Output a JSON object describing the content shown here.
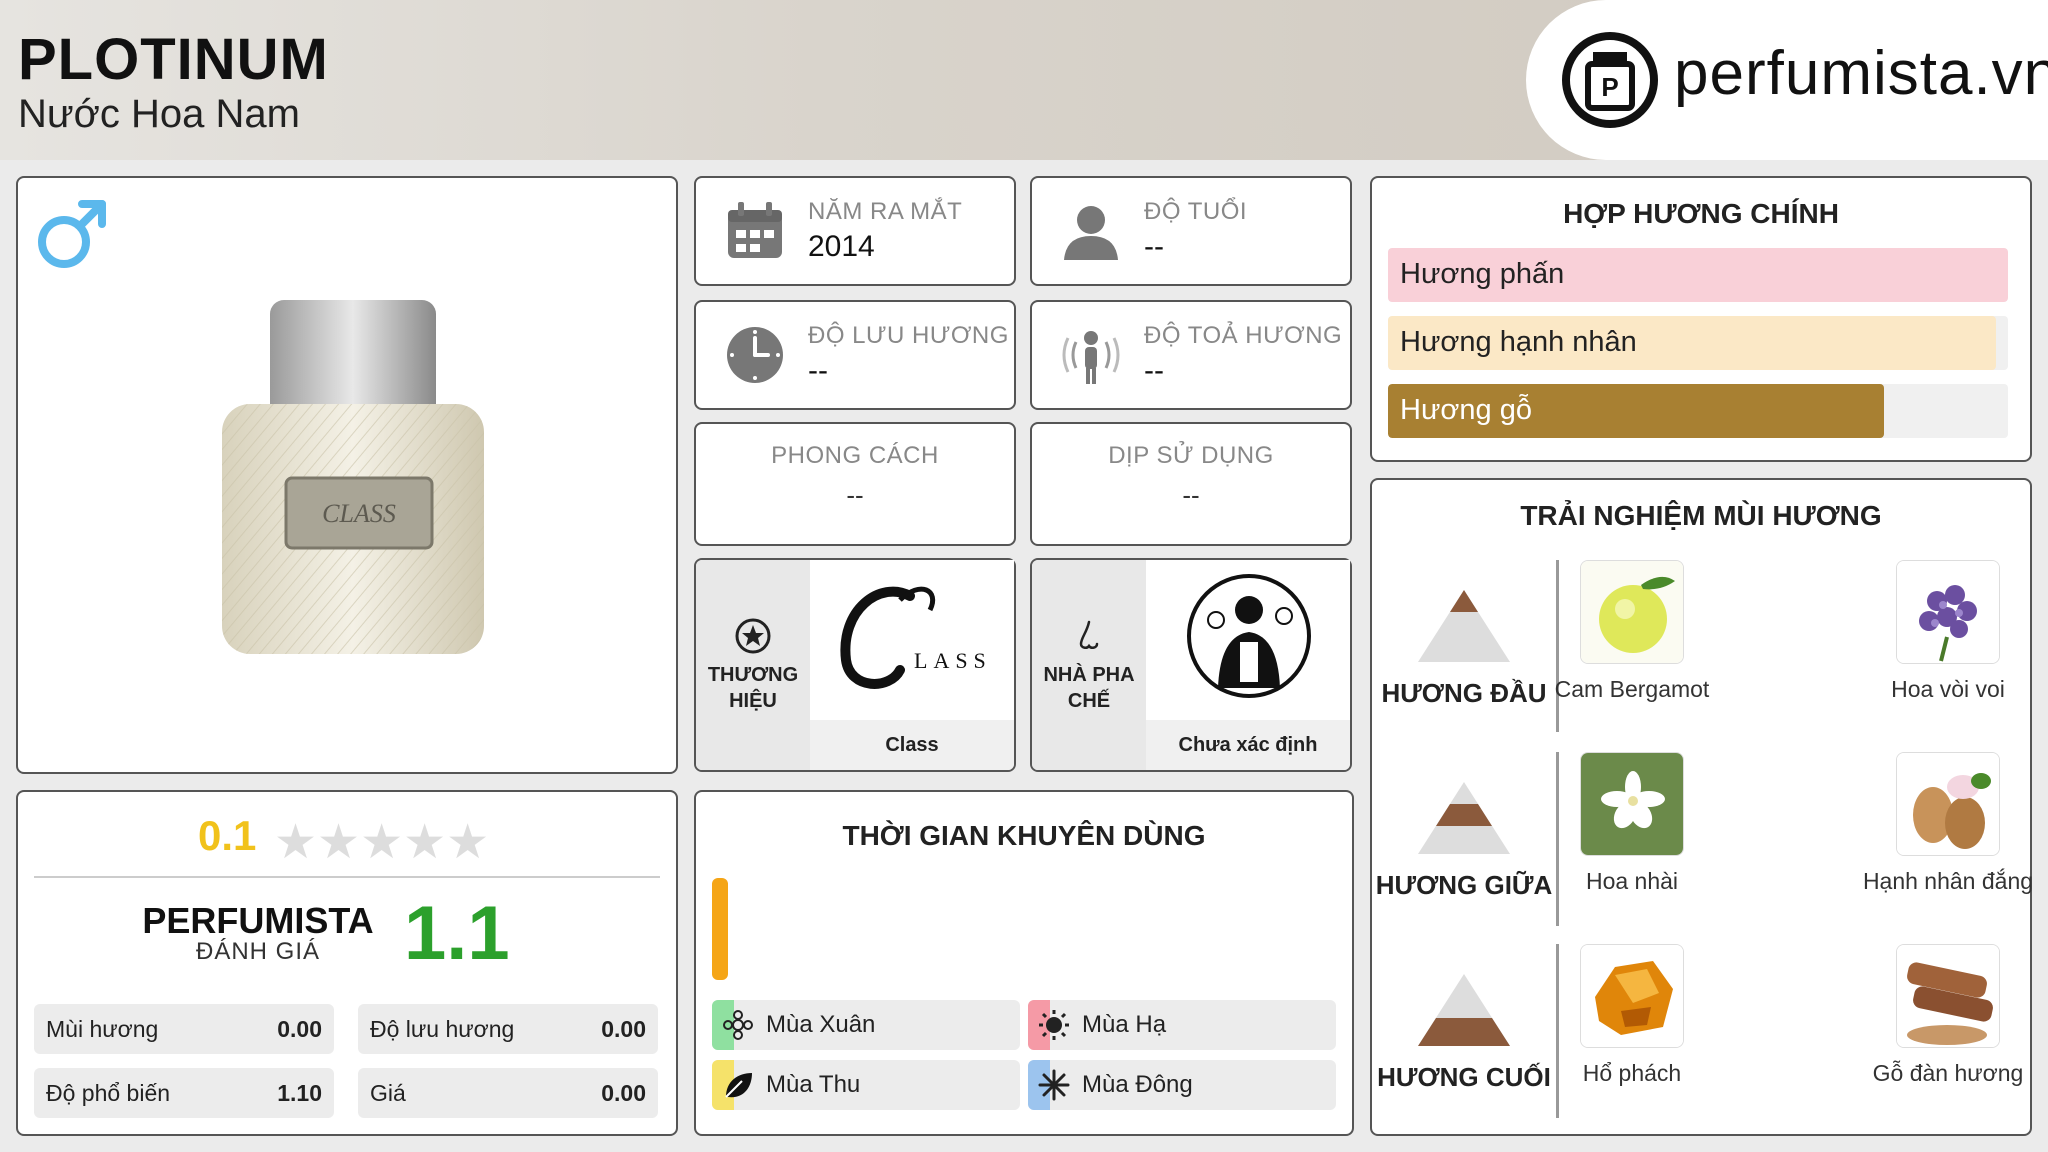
{
  "header": {
    "title": "PLOTINUM",
    "subtitle": "Nước Hoa Nam",
    "logo_text": "perfumista.vn"
  },
  "product": {
    "gender_icon": "male-symbol-icon",
    "bottle_label": "CLASS"
  },
  "info": {
    "launch_year": {
      "label": "NĂM RA MẮT",
      "value": "2014",
      "icon": "calendar-icon"
    },
    "age": {
      "label": "ĐỘ TUỔI",
      "value": "--",
      "icon": "person-icon"
    },
    "longevity": {
      "label": "ĐỘ LƯU HƯƠNG",
      "value": "--",
      "icon": "clock-icon"
    },
    "sillage": {
      "label": "ĐỘ TOẢ HƯƠNG",
      "value": "--",
      "icon": "radiating-person-icon"
    },
    "style": {
      "label": "PHONG CÁCH",
      "value": "--"
    },
    "occasion": {
      "label": "DỊP SỬ DỤNG",
      "value": "--"
    }
  },
  "brand": {
    "label": "THƯƠNG HIỆU",
    "name": "Class",
    "logo_text": "LASS"
  },
  "perfumer": {
    "label": "NHÀ PHA CHẾ",
    "name": "Chưa xác định"
  },
  "accords": {
    "title": "HỢP HƯƠNG CHÍNH",
    "items": [
      {
        "label": "Hương phấn",
        "fill": 1.0,
        "color": "#f9d0d8",
        "text_color": "#222222"
      },
      {
        "label": "Hương hạnh nhân",
        "fill": 0.98,
        "color": "#fbe8c6",
        "text_color": "#222222"
      },
      {
        "label": "Hương gỗ",
        "fill": 0.8,
        "color": "#a88032",
        "text_color": "#ffffff"
      }
    ]
  },
  "notes": {
    "title": "TRẢI NGHIỆM MÙI HƯƠNG",
    "tiers": [
      {
        "label": "HƯƠNG ĐẦU",
        "notes": [
          "Cam Bergamot",
          "Hoa vòi voi"
        ]
      },
      {
        "label": "HƯƠNG GIỮA",
        "notes": [
          "Hoa nhài",
          "Hạnh nhân đắng"
        ]
      },
      {
        "label": "HƯƠNG CUỐI",
        "notes": [
          "Hổ phách",
          "Gỗ đàn hương"
        ]
      }
    ]
  },
  "rating": {
    "user_score": "0.1",
    "stars_filled": 0.02,
    "brand": "PERFUMISTA",
    "sub": "ĐÁNH GIÁ",
    "score": "1.1",
    "metrics": [
      {
        "label": "Mùi hương",
        "value": "0.00"
      },
      {
        "label": "Độ lưu hương",
        "value": "0.00"
      },
      {
        "label": "Độ phổ biến",
        "value": "1.10"
      },
      {
        "label": "Giá",
        "value": "0.00"
      }
    ]
  },
  "seasons": {
    "title": "THỜI GIAN KHUYÊN DÙNG",
    "items": [
      {
        "label": "Mùa Xuân",
        "color": "#8fe0a0",
        "icon": "flower-icon"
      },
      {
        "label": "Mùa Hạ",
        "color": "#f59aa6",
        "icon": "sun-icon"
      },
      {
        "label": "Mùa Thu",
        "color": "#f5e26a",
        "icon": "leaf-icon"
      },
      {
        "label": "Mùa Đông",
        "color": "#9cc4ee",
        "icon": "snowflake-icon"
      }
    ]
  },
  "colors": {
    "star_gold": "#f1c21b",
    "score_green": "#2ca02c",
    "season_bar": "#f5a516"
  }
}
